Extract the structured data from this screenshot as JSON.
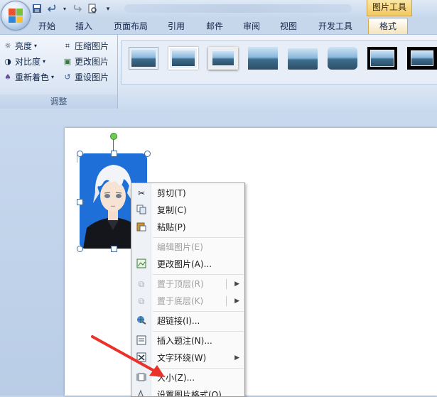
{
  "window": {
    "tool_title": "图片工具",
    "quick_access": [
      "save-icon",
      "undo-icon",
      "redo-icon",
      "print-preview-icon",
      "customize-icon"
    ]
  },
  "tabs": [
    {
      "label": "开始",
      "active": false
    },
    {
      "label": "插入",
      "active": false
    },
    {
      "label": "页面布局",
      "active": false
    },
    {
      "label": "引用",
      "active": false
    },
    {
      "label": "邮件",
      "active": false
    },
    {
      "label": "审阅",
      "active": false
    },
    {
      "label": "视图",
      "active": false
    },
    {
      "label": "开发工具",
      "active": false
    },
    {
      "label": "格式",
      "active": true
    }
  ],
  "ribbon": {
    "adjust_group": {
      "brightness": "亮度",
      "contrast": "对比度",
      "recolor": "重新着色",
      "compress": "压缩图片",
      "change_picture": "更改图片",
      "reset_picture": "重设图片",
      "label": "调整"
    },
    "picture_styles_count": 8
  },
  "context_menu": {
    "items": [
      {
        "label": "剪切(T)",
        "icon": "scissors-icon",
        "disabled": false
      },
      {
        "label": "复制(C)",
        "icon": "copy-icon",
        "disabled": false
      },
      {
        "label": "粘贴(P)",
        "icon": "paste-icon",
        "disabled": false
      },
      {
        "label": "编辑图片(E)",
        "icon": "",
        "disabled": true
      },
      {
        "label": "更改图片(A)...",
        "icon": "change-picture-icon",
        "disabled": false
      },
      {
        "label": "置于顶层(R)",
        "icon": "bring-front-icon",
        "disabled": true,
        "submenu": true
      },
      {
        "label": "置于底层(K)",
        "icon": "send-back-icon",
        "disabled": true,
        "submenu": true
      },
      {
        "label": "超链接(I)...",
        "icon": "hyperlink-icon",
        "disabled": false
      },
      {
        "label": "插入题注(N)...",
        "icon": "caption-icon",
        "disabled": false
      },
      {
        "label": "文字环绕(W)",
        "icon": "text-wrap-icon",
        "disabled": false,
        "submenu": true
      },
      {
        "label": "大小(Z)...",
        "icon": "size-icon",
        "disabled": false
      },
      {
        "label": "设置图片格式(O)...",
        "icon": "format-picture-icon",
        "disabled": false
      }
    ]
  },
  "colors": {
    "ribbon_bg": "#dbe6f4",
    "active_tab": "#f4e3b8",
    "tool_title_bg": "#f2c960",
    "picture_bg": "#1f6fd8",
    "annotation_arrow": "#e8322a"
  }
}
